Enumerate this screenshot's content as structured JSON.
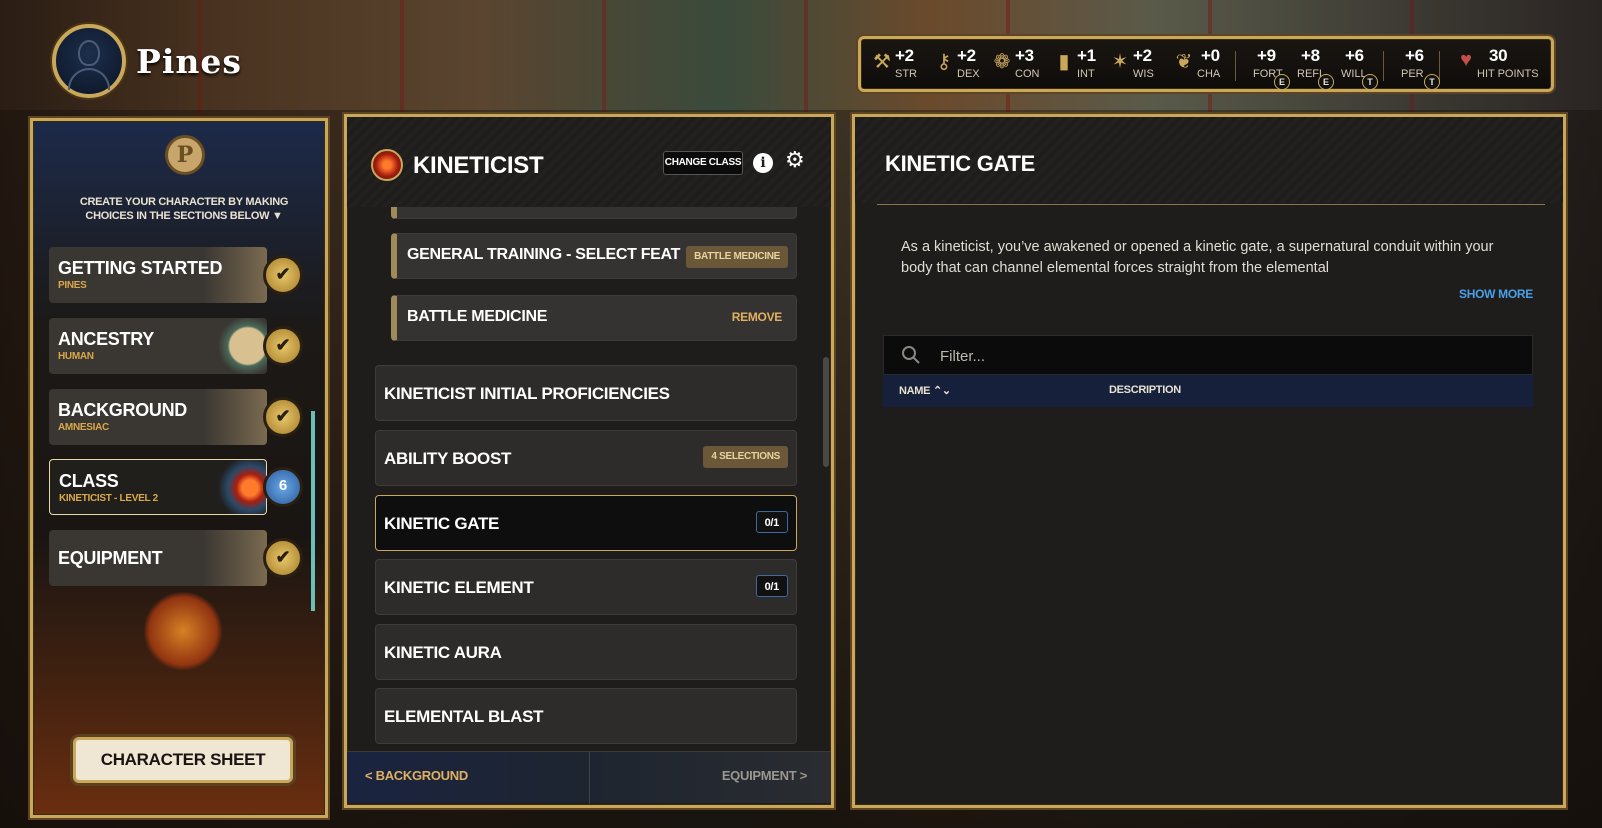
{
  "character": {
    "name": "Pines"
  },
  "stats": [
    {
      "value": "+2",
      "label": "STR",
      "icon": "hammer-icon"
    },
    {
      "value": "+2",
      "label": "DEX",
      "icon": "key-icon"
    },
    {
      "value": "+3",
      "label": "CON",
      "icon": "wreath-icon"
    },
    {
      "value": "+1",
      "label": "INT",
      "icon": "book-icon"
    },
    {
      "value": "+2",
      "label": "WIS",
      "icon": "star-icon"
    },
    {
      "value": "+0",
      "label": "CHA",
      "icon": "laurel-icon"
    },
    {
      "value": "+9",
      "label": "FORT",
      "prof": "E"
    },
    {
      "value": "+8",
      "label": "REFL",
      "prof": "E"
    },
    {
      "value": "+6",
      "label": "WILL",
      "prof": "T"
    },
    {
      "value": "+6",
      "label": "PER",
      "prof": "T"
    },
    {
      "value": "30",
      "label": "HIT POINTS",
      "icon": "heart-icon"
    }
  ],
  "sidebar": {
    "emblem": "P",
    "intro": "CREATE YOUR CHARACTER BY MAKING CHOICES IN THE SECTIONS BELOW ▼",
    "steps": [
      {
        "title": "GETTING STARTED",
        "sub": "PINES",
        "status": "✔"
      },
      {
        "title": "ANCESTRY",
        "sub": "HUMAN",
        "status": "✔"
      },
      {
        "title": "BACKGROUND",
        "sub": "AMNESIAC",
        "status": "✔"
      },
      {
        "title": "CLASS",
        "sub": "KINETICIST - LEVEL 2",
        "status": "6"
      },
      {
        "title": "EQUIPMENT",
        "sub": "",
        "status": "✔"
      }
    ],
    "character_sheet_label": "CHARACTER SHEET"
  },
  "class_panel": {
    "title": "KINETICIST",
    "change_class_label": "CHANGE CLASS",
    "info_glyph": "i",
    "gear_glyph": "⚙",
    "rows": [
      {
        "label": "GENERAL TRAINING - SELECT FEAT",
        "badge": "BATTLE MEDICINE"
      },
      {
        "label": "BATTLE MEDICINE",
        "action": "REMOVE"
      },
      {
        "label": "KINETICIST INITIAL PROFICIENCIES"
      },
      {
        "label": "ABILITY BOOST",
        "badge": "4 SELECTIONS"
      },
      {
        "label": "KINETIC GATE",
        "count": "0/1"
      },
      {
        "label": "KINETIC ELEMENT",
        "count": "0/1"
      },
      {
        "label": "KINETIC AURA"
      },
      {
        "label": "ELEMENTAL BLAST"
      }
    ],
    "back_label": "< BACKGROUND",
    "next_label": "EQUIPMENT >"
  },
  "detail_panel": {
    "title": "KINETIC GATE",
    "description": "As a kineticist, you’ve awakened or opened a kinetic gate, a supernatural conduit within your body that can channel elemental forces straight from the elemental",
    "show_more_label": "SHOW MORE",
    "filter_placeholder": "Filter...",
    "columns": {
      "name": "NAME ⌃⌄",
      "description": "DESCRIPTION"
    }
  },
  "colors": {
    "gold": "#c9a75b",
    "accent_blue": "#4aa0e8",
    "check_teal": "#6ac0b8"
  }
}
